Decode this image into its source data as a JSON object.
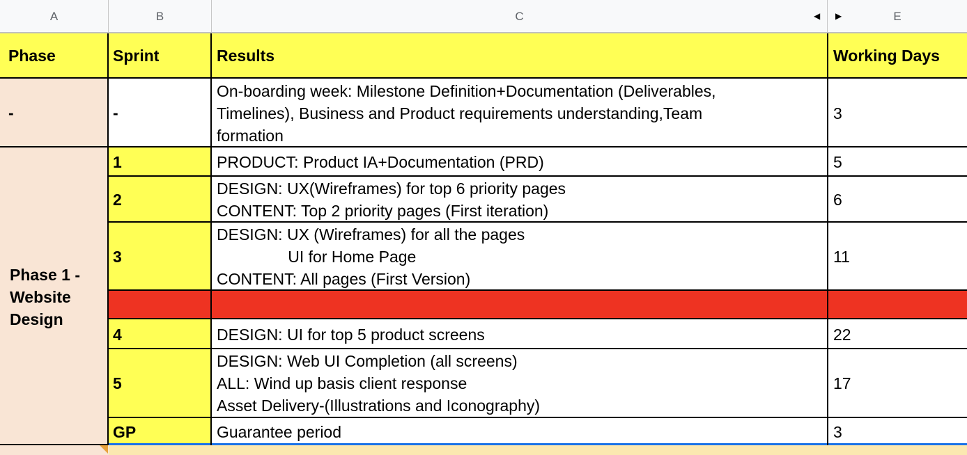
{
  "columns": [
    "A",
    "B",
    "C",
    "",
    "E"
  ],
  "arrows": {
    "left": "◀",
    "right": "▶"
  },
  "header": {
    "phase": "Phase",
    "sprint": "Sprint",
    "results": "Results",
    "working_days": "Working Days"
  },
  "rows": [
    {
      "phase": "-",
      "sprint": "-",
      "results": [
        "On-boarding week: Milestone Definition+Documentation (Deliverables,",
        "Timelines), Business and Product requirements understanding,Team",
        "formation"
      ],
      "days": "3"
    },
    {
      "sprint": "1",
      "results": [
        "PRODUCT: Product IA+Documentation (PRD)"
      ],
      "days": "5"
    },
    {
      "sprint": "2",
      "results": [
        "DESIGN: UX(Wireframes) for top 6 priority pages",
        "CONTENT: Top 2 priority pages (First iteration)"
      ],
      "days": "6"
    },
    {
      "sprint": "3",
      "results": [
        "DESIGN: UX (Wireframes) for all the pages",
        "                UI for Home Page",
        "CONTENT: All pages (First Version)"
      ],
      "days": "11"
    },
    {
      "sprint": "4",
      "results": [
        "DESIGN: UI for top 5 product screens"
      ],
      "days": "22"
    },
    {
      "sprint": "5",
      "results": [
        "DESIGN: Web UI Completion (all screens)",
        "ALL: Wind up basis client response",
        "Asset Delivery-(Illustrations and Iconography)"
      ],
      "days": "17"
    },
    {
      "sprint": "GP",
      "results": [
        "Guarantee period"
      ],
      "days": "3"
    }
  ],
  "phase1_label": [
    "Phase 1 -",
    "Website",
    "Design"
  ],
  "colors": {
    "header_yellow": "#ffff55",
    "phase_peach": "#f9e5d5",
    "separator_red": "#ee3322",
    "selection_blue": "#1a73e8"
  }
}
